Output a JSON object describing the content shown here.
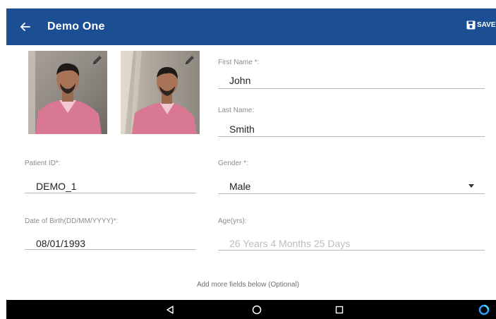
{
  "appbar": {
    "title": "Demo One",
    "save_label": "SAVE",
    "bar_color": "#1c4e93"
  },
  "form": {
    "first_name": {
      "label": "First Name *:",
      "value": "John"
    },
    "last_name": {
      "label": "Last Name:",
      "value": "Smith"
    },
    "patient_id": {
      "label": "Patient ID*:",
      "value": "DEMO_1"
    },
    "gender": {
      "label": "Gender *:",
      "value": "Male"
    },
    "dob": {
      "label": "Date of Birth(DD/MM/YYYY)*:",
      "value": "08/01/1993"
    },
    "age": {
      "label": "Age(yrs):",
      "value": "26 Years 4 Months 25 Days"
    }
  },
  "footer": {
    "note": "Add more fields below (Optional)"
  },
  "icons": {
    "back": "arrow-left-icon",
    "save": "save-icon",
    "edit": "pencil-icon",
    "nav_back": "triangle-back-icon",
    "nav_home": "circle-home-icon",
    "nav_recents": "square-recents-icon",
    "assistant": "assistant-icon"
  }
}
